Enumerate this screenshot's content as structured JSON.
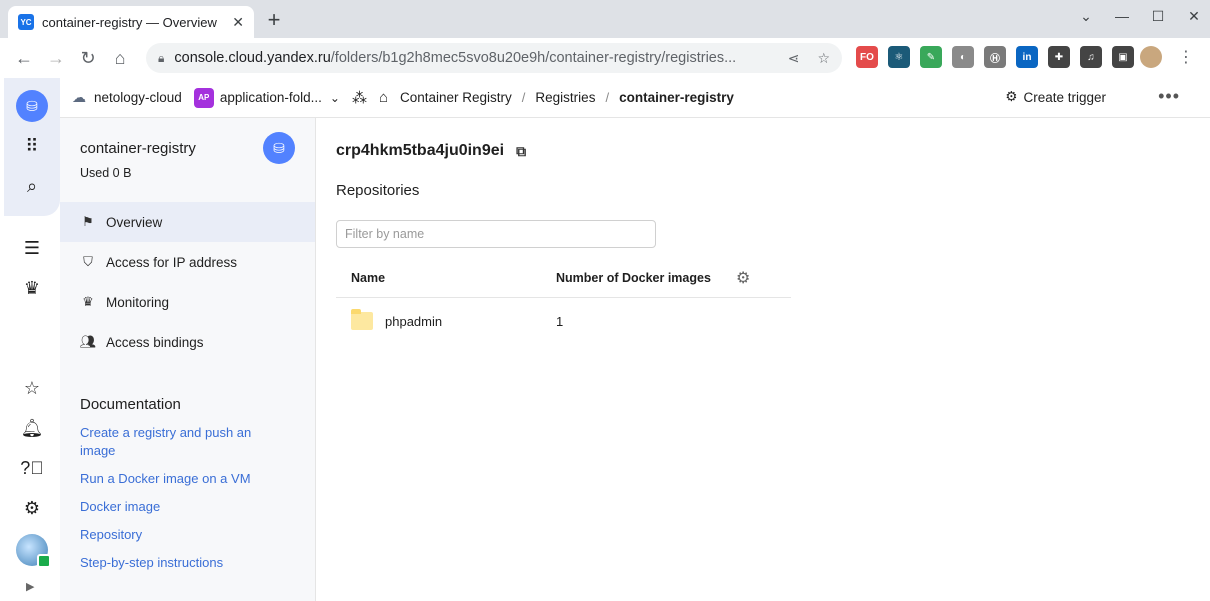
{
  "browser": {
    "tab_favicon": "YC",
    "tab_title": "container-registry — Overview",
    "url_host": "console.cloud.yandex.ru",
    "url_path": "/folders/b1g2h8mec5svo8u20e9h/container-registry/registries...",
    "extensions": [
      {
        "name": "fo-ext",
        "label": "FO",
        "color": "#e44b4b"
      },
      {
        "name": "react-devtools-ext",
        "label": "⚛",
        "color": "#1b5a78"
      },
      {
        "name": "leaf-ext",
        "label": "✎",
        "color": "#39a85a"
      },
      {
        "name": "badge-ext",
        "label": "◐",
        "color": "#8a8a8a"
      },
      {
        "name": "h-ext",
        "label": "Ⓗ",
        "color": "#7a7a7a"
      },
      {
        "name": "linkedin-ext",
        "label": "in",
        "color": "#0a66c2"
      },
      {
        "name": "puzzle-ext",
        "label": "✚",
        "color": "#444"
      },
      {
        "name": "media-ext",
        "label": "♫",
        "color": "#444"
      },
      {
        "name": "sidepanel-ext",
        "label": "▣",
        "color": "#444"
      }
    ]
  },
  "topbar": {
    "cloud": "netology-cloud",
    "folder_badge": "AP",
    "folder": "application-fold...",
    "breadcrumbs": [
      "Container Registry",
      "Registries",
      "container-registry"
    ],
    "create_trigger": "Create trigger"
  },
  "sidebar": {
    "title": "container-registry",
    "used": "Used 0 B",
    "items": [
      {
        "label": "Overview",
        "icon": "flag-icon",
        "active": true
      },
      {
        "label": "Access for IP address",
        "icon": "shield-icon"
      },
      {
        "label": "Monitoring",
        "icon": "chart-icon"
      },
      {
        "label": "Access bindings",
        "icon": "people-icon"
      }
    ],
    "docs_title": "Documentation",
    "docs": [
      "Create a registry and push an image",
      "Run a Docker image on a VM",
      "Docker image",
      "Repository",
      "Step-by-step instructions"
    ]
  },
  "main": {
    "registry_id": "crp4hkm5tba4ju0in9ei",
    "repositories_title": "Repositories",
    "filter_placeholder": "Filter by name",
    "columns": [
      "Name",
      "Number of Docker images"
    ],
    "rows": [
      {
        "name": "phpadmin",
        "count": "1"
      }
    ]
  }
}
